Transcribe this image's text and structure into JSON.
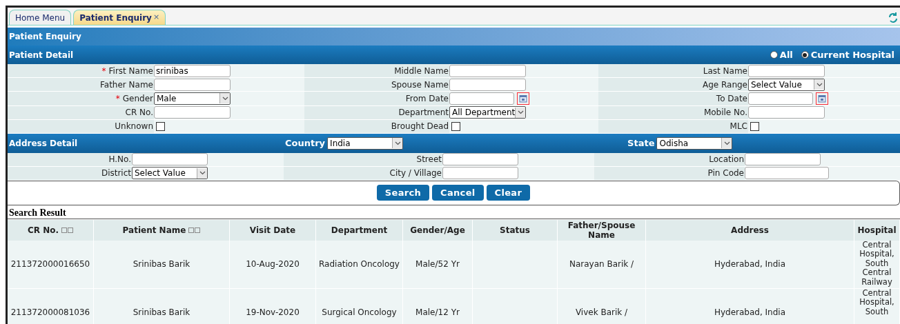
{
  "tabs": [
    {
      "label": "Home Menu",
      "selected": false
    },
    {
      "label": "Patient Enquiry",
      "selected": true,
      "close": "×"
    }
  ],
  "page_title": "Patient Enquiry",
  "patient_detail": {
    "title": "Patient Detail",
    "scope_options": [
      {
        "label": "All",
        "selected": false
      },
      {
        "label": "Current Hospital",
        "selected": true
      }
    ],
    "fields": [
      {
        "label": "First Name",
        "required_mark": "*",
        "kind": "text",
        "value": "srinibas"
      },
      {
        "label": "Middle Name",
        "kind": "text"
      },
      {
        "label": "Last Name",
        "kind": "text"
      },
      {
        "label": "Father Name",
        "kind": "text"
      },
      {
        "label": "Spouse Name",
        "kind": "text"
      },
      {
        "label": "Age Range",
        "kind": "select",
        "value": "Select Value"
      },
      {
        "label": "Gender",
        "required_mark": "*",
        "kind": "select",
        "value": "Male"
      },
      {
        "label": "From Date",
        "kind": "date"
      },
      {
        "label": "To Date",
        "kind": "date"
      },
      {
        "label": "CR No.",
        "kind": "text"
      },
      {
        "label": "Department",
        "kind": "select",
        "value": "All Department"
      },
      {
        "label": "Mobile No.",
        "kind": "text"
      },
      {
        "label": "Unknown",
        "kind": "checkbox",
        "checked": false
      },
      {
        "label": "Brought Dead",
        "kind": "checkbox",
        "checked": false
      },
      {
        "label": "MLC",
        "kind": "checkbox",
        "checked": false
      }
    ]
  },
  "address_detail": {
    "title": "Address Detail",
    "country_label": "Country",
    "country": "India",
    "state_label": "State",
    "state": "Odisha",
    "fields": [
      {
        "label": "H.No.",
        "kind": "text"
      },
      {
        "label": "Street",
        "kind": "text"
      },
      {
        "label": "Location",
        "kind": "text"
      },
      {
        "label": "District",
        "kind": "select",
        "value": "Select Value"
      },
      {
        "label": "City / Village",
        "kind": "text"
      },
      {
        "label": "Pin Code",
        "kind": "text"
      }
    ]
  },
  "buttons": [
    "Search",
    "Cancel",
    "Clear"
  ],
  "results": {
    "title": "Search Result",
    "columns": [
      {
        "label": "CR No.",
        "sortable": true
      },
      {
        "label": "Patient Name",
        "sortable": true
      },
      {
        "label": "Visit Date",
        "sortable": false
      },
      {
        "label": "Department",
        "sortable": false
      },
      {
        "label": "Gender/Age",
        "sortable": false
      },
      {
        "label": "Status",
        "sortable": false
      },
      {
        "label": "Father/Spouse Name",
        "sortable": false
      },
      {
        "label": "Address",
        "sortable": false
      },
      {
        "label": "Hospital",
        "sortable": false
      }
    ],
    "rows": [
      [
        "211372000016650",
        "Srinibas Barik",
        "10-Aug-2020",
        "Radiation Oncology",
        "Male/52 Yr",
        "",
        "Narayan Barik /",
        "Hyderabad, India",
        "Central Hospital, South Central Railway"
      ],
      [
        "211372000081036",
        "Srinibas Barik",
        "19-Nov-2020",
        "Surgical Oncology",
        "Male/12 Yr",
        "",
        "Vivek Barik /",
        "Hyderabad, India",
        "Central Hospital, South"
      ]
    ]
  }
}
